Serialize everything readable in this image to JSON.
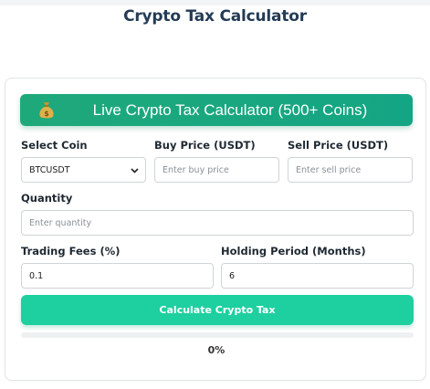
{
  "page": {
    "title": "Crypto Tax Calculator"
  },
  "banner": {
    "icon": "money-bag-icon",
    "title": "Live Crypto Tax Calculator (500+ Coins)"
  },
  "form": {
    "select_coin": {
      "label": "Select Coin",
      "value": "BTCUSDT"
    },
    "buy_price": {
      "label": "Buy Price (USDT)",
      "placeholder": "Enter buy price",
      "value": ""
    },
    "sell_price": {
      "label": "Sell Price (USDT)",
      "placeholder": "Enter sell price",
      "value": ""
    },
    "quantity": {
      "label": "Quantity",
      "placeholder": "Enter quantity",
      "value": ""
    },
    "trading_fees": {
      "label": "Trading Fees (%)",
      "value": "0.1"
    },
    "holding_period": {
      "label": "Holding Period (Months)",
      "value": "6"
    }
  },
  "actions": {
    "calculate_label": "Calculate Crypto Tax"
  },
  "progress": {
    "percent": 0,
    "text": "0%"
  },
  "colors": {
    "title": "#243b55",
    "banner": "#1fa97a",
    "button": "#1ecfa0"
  }
}
